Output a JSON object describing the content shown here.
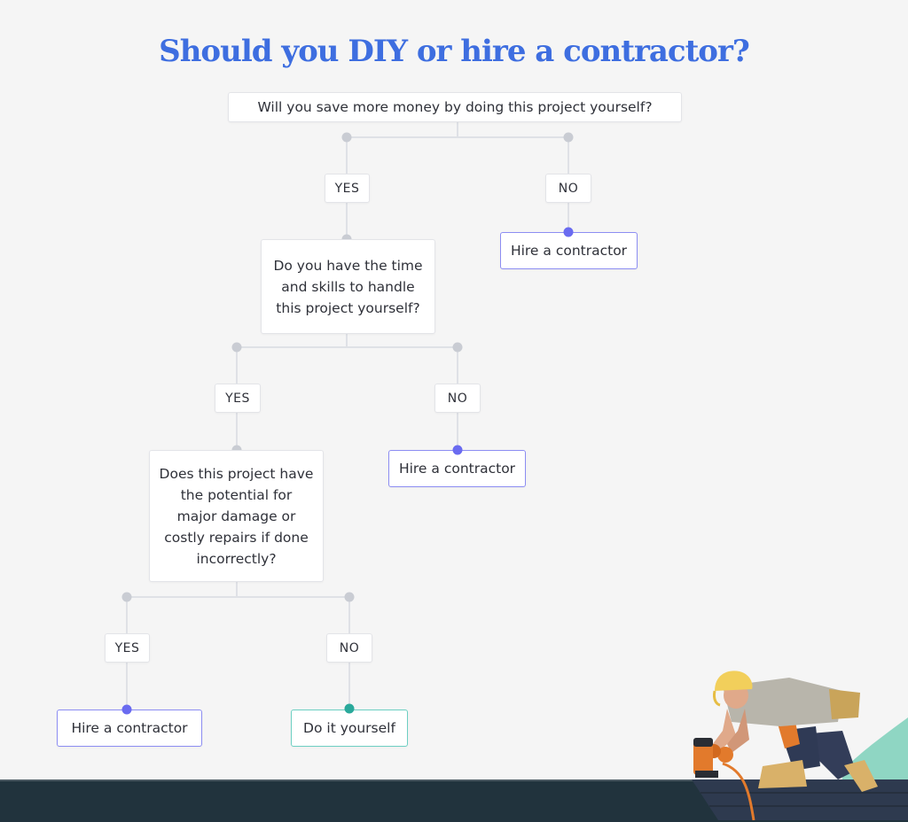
{
  "title": "Should you DIY or hire a contractor?",
  "colors": {
    "title": "#3e6ee0",
    "hire_accent": "#6a6bf0",
    "diy_accent": "#2aa99b",
    "footer": "#21333d",
    "background": "#f5f5f5"
  },
  "flowchart": {
    "q1": {
      "question": "Will you save more money by doing this project yourself?",
      "yes_label": "YES",
      "no_label": "NO",
      "no_outcome": "Hire a contractor"
    },
    "q2": {
      "question": "Do you have the time and skills to handle this project yourself?",
      "yes_label": "YES",
      "no_label": "NO",
      "no_outcome": "Hire a contractor"
    },
    "q3": {
      "question": "Does this project have the potential for major damage or costly repairs if done incorrectly?",
      "yes_label": "YES",
      "no_label": "NO",
      "yes_outcome": "Hire a contractor",
      "no_outcome": "Do it yourself"
    }
  },
  "illustration": {
    "icon": "roofer-with-nail-gun-illustration"
  }
}
